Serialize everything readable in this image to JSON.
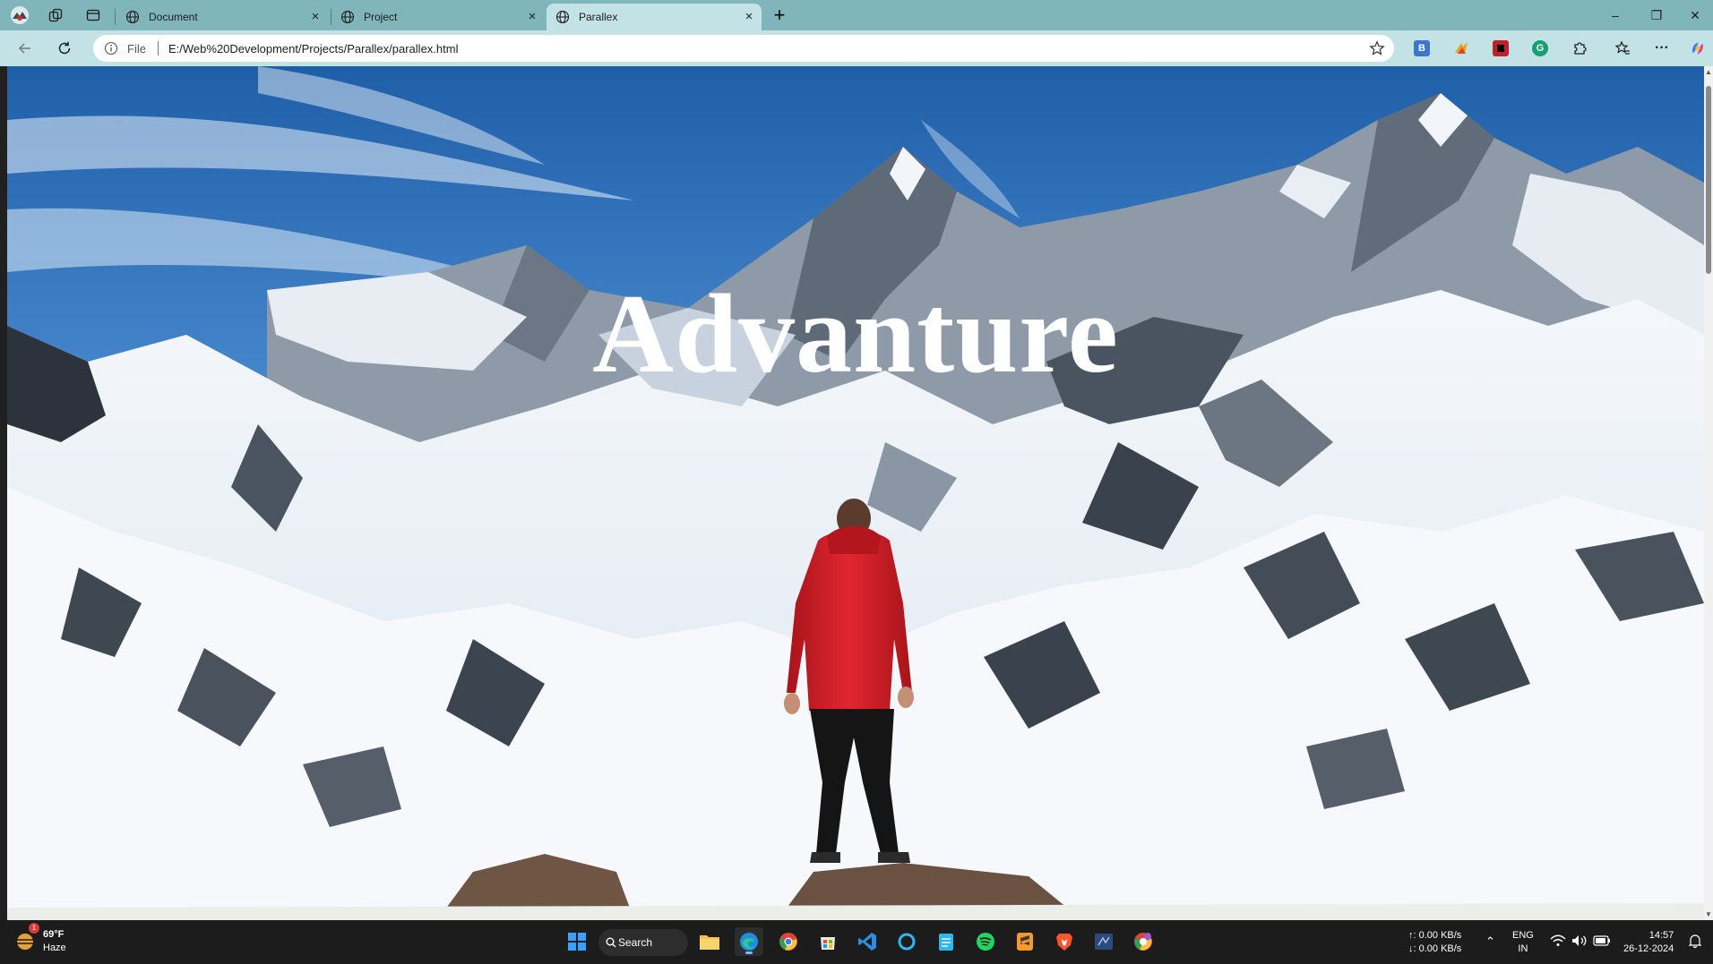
{
  "browser": {
    "tabs": [
      {
        "title": "Document",
        "active": false
      },
      {
        "title": "Project",
        "active": false
      },
      {
        "title": "Parallex",
        "active": true
      }
    ],
    "new_tab_label": "+",
    "window_controls": {
      "minimize": "–",
      "restore": "❐",
      "close": "✕"
    },
    "address": {
      "scheme_label": "File",
      "url": "E:/Web%20Development/Projects/Parallex/parallex.html"
    },
    "extensions": [
      "bold-b-extension-icon",
      "paint-extension-icon",
      "red-extension-icon",
      "grammarly-icon",
      "puzzle-extensions-icon"
    ],
    "accent_color": "#7fb5bb"
  },
  "page": {
    "hero_title": "Advanture"
  },
  "taskbar": {
    "weather": {
      "temp": "69°F",
      "condition": "Haze",
      "badge": "1"
    },
    "search_label": "Search",
    "apps": [
      "start-icon",
      "file-explorer-icon",
      "edge-icon",
      "chrome-icon",
      "store-icon",
      "vscode-icon",
      "cortana-icon",
      "notepad-icon",
      "spotify-icon",
      "sublime-icon",
      "brave-icon",
      "sql-icon",
      "chrome-canary-icon"
    ],
    "network": {
      "up": "↑: 0.00 KB/s",
      "down": "↓: 0.00 KB/s"
    },
    "language": {
      "lang": "ENG",
      "region": "IN"
    },
    "clock": {
      "time": "14:57",
      "date": "26-12-2024"
    }
  }
}
